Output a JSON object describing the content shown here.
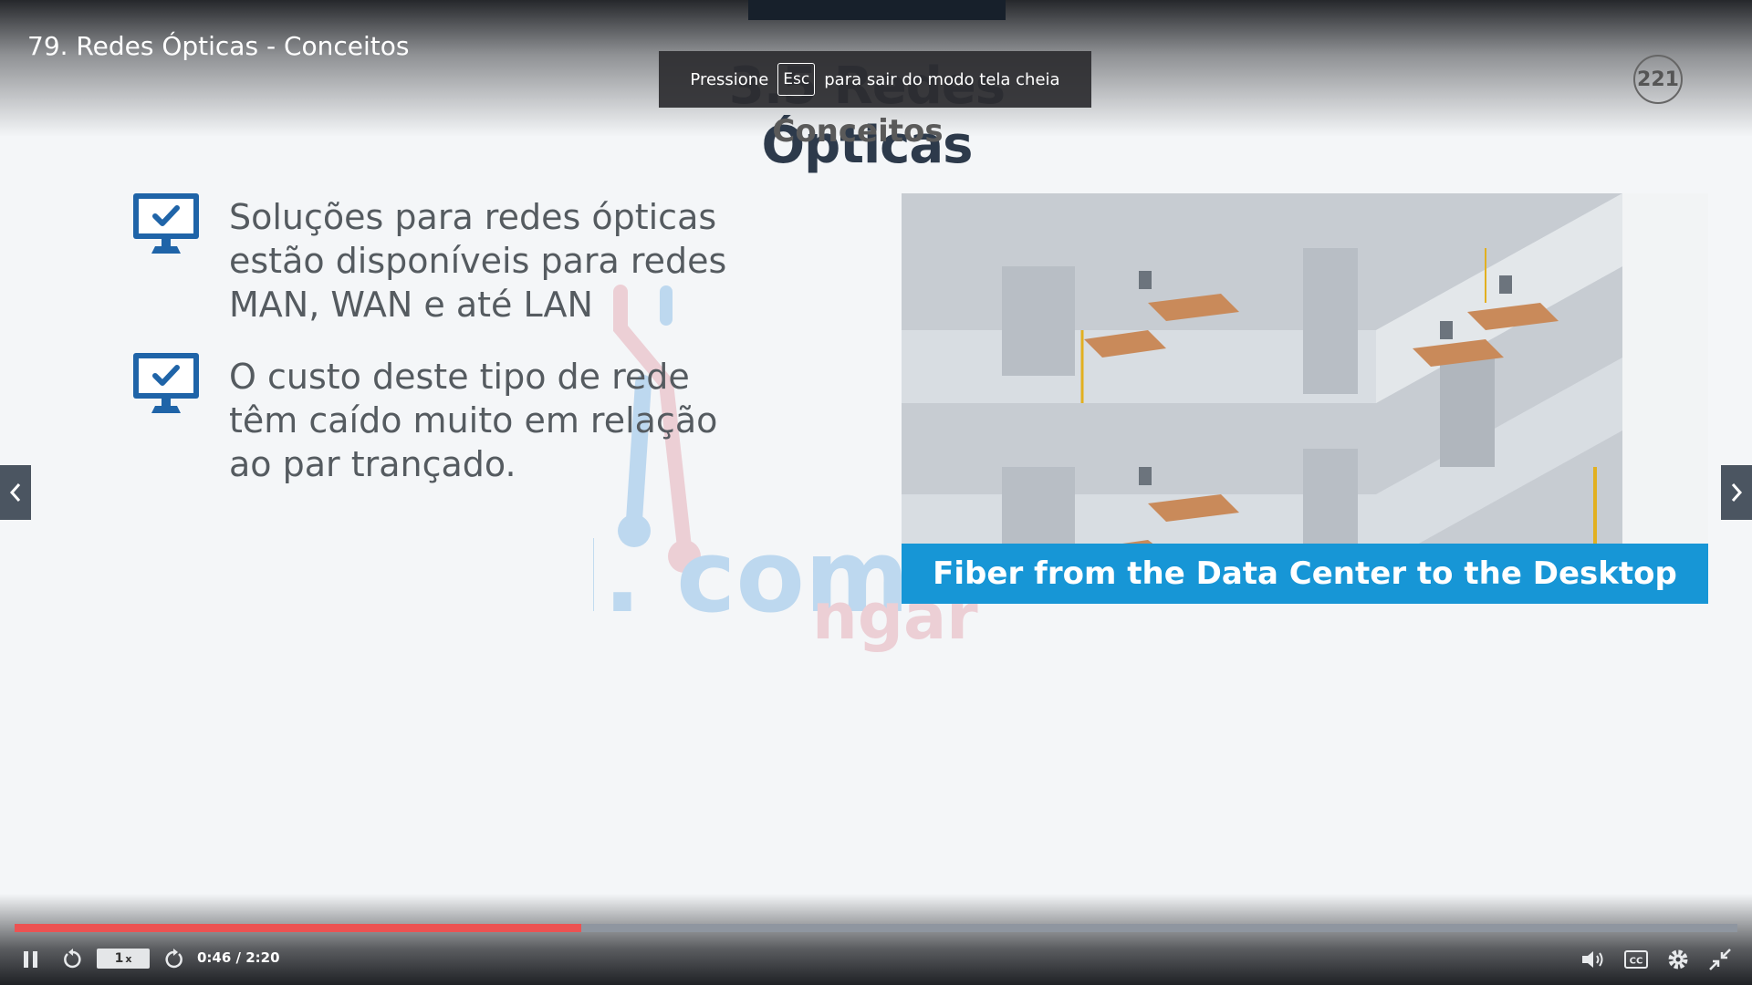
{
  "lecture": {
    "title": "79. Redes Ópticas - Conceitos"
  },
  "slide": {
    "title": "3.5 Redes Ópticas",
    "subtitle": "Conceitos",
    "number": "221",
    "bullets": [
      {
        "text": "Soluções para redes ópticas estão disponíveis para redes MAN, WAN e até LAN"
      },
      {
        "text": "O custo deste tipo de rede têm caído muito em relação ao par trançado."
      }
    ],
    "image_caption": "Fiber from the Data Center to the Desktop"
  },
  "fullscreen_notice": {
    "before": "Pressione",
    "key": "Esc",
    "after": "para sair do modo tela cheia"
  },
  "player": {
    "speed": "1",
    "speed_suffix": "x",
    "time": "0:46 / 2:20",
    "progress_fraction": 0.329,
    "accent_color": "#ec5252"
  },
  "icons": {
    "bullet": "monitor-check-icon",
    "prev": "chevron-left-icon",
    "next": "chevron-right-icon",
    "play_pause": "pause-icon",
    "rewind": "rewind-5-icon",
    "forward": "forward-5-icon",
    "volume": "volume-icon",
    "captions": "cc-icon",
    "settings": "gear-icon",
    "fullscreen_exit": "exit-fullscreen-icon"
  }
}
